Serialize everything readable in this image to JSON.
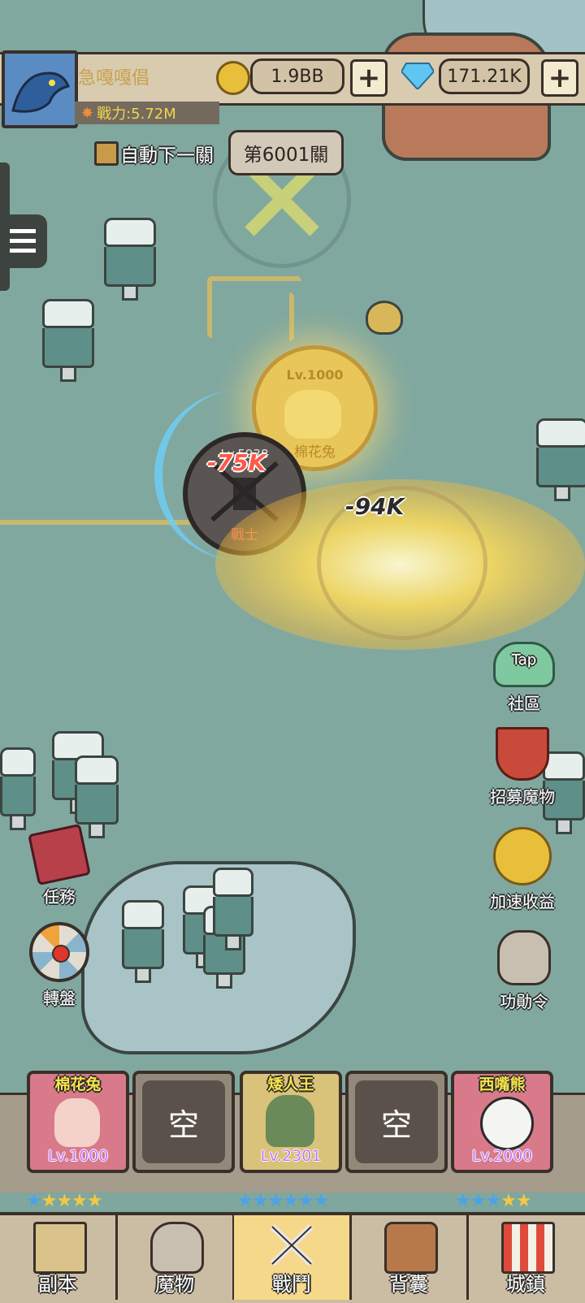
{
  "player": {
    "name": "急嘎嘎倡",
    "power": "戰力:5.72M"
  },
  "currency": {
    "gold": "1.9BB",
    "gems": "171.21K",
    "plus": "+"
  },
  "stage": {
    "auto_next_label": "自動下一關",
    "stage_label": "第6001關"
  },
  "battle": {
    "enemy_level": "Lv.5938",
    "enemy_name": "戰士",
    "damage_1": "-75K",
    "damage_2": "-94K",
    "ally_level": "Lv.1000",
    "ally_name": "棉花兔"
  },
  "side_right": [
    {
      "label": "社區",
      "badge": "Tap"
    },
    {
      "label": "招募魔物"
    },
    {
      "label": "加速收益"
    },
    {
      "label": "功勛令"
    }
  ],
  "side_left": [
    {
      "label": "任務"
    },
    {
      "label": "轉盤"
    }
  ],
  "team": [
    {
      "name": "棉花兔",
      "level": "Lv.1000",
      "stars": 5,
      "filled": 4,
      "star_color": "#4aa3e6"
    },
    {
      "empty": "空"
    },
    {
      "name": "矮人王",
      "level": "Lv.2301",
      "stars": 6,
      "filled": 6,
      "star_color": "#4aa3e6"
    },
    {
      "empty": "空"
    },
    {
      "name": "西嘴熊",
      "level": "Lv.2000",
      "stars": 5,
      "filled": 3,
      "star_color": "#4aa3e6"
    }
  ],
  "nav": [
    {
      "label": "副本"
    },
    {
      "label": "魔物"
    },
    {
      "label": "戰鬥",
      "active": true
    },
    {
      "label": "背囊"
    },
    {
      "label": "城鎮"
    }
  ]
}
